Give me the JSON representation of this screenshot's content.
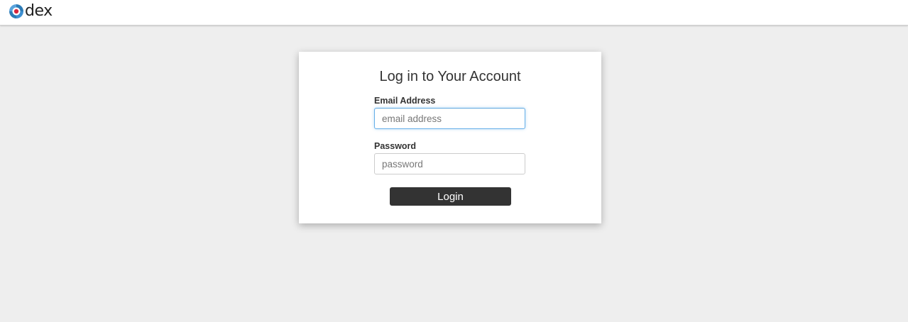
{
  "header": {
    "logo_text": "dex"
  },
  "login": {
    "title": "Log in to Your Account",
    "email_label": "Email Address",
    "email_placeholder": "email address",
    "email_value": "",
    "password_label": "Password",
    "password_placeholder": "password",
    "password_value": "",
    "submit_label": "Login"
  },
  "colors": {
    "background": "#eeeeee",
    "card": "#ffffff",
    "button": "#333333",
    "focus_ring": "#66afe9",
    "logo_blue": "#2c7bb6",
    "logo_red": "#d7263d"
  }
}
